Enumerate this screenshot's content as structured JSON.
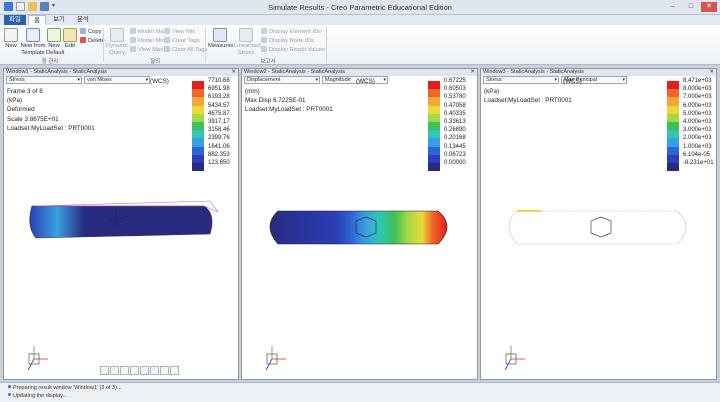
{
  "window": {
    "title": "Simulate Results - Creo Parametric Educational Edition",
    "min": "–",
    "max": "□",
    "close": "✕"
  },
  "tabs": [
    "파일",
    "홈",
    "보기",
    "분석"
  ],
  "ribbon": {
    "new": "New",
    "new_template": "New from Template",
    "new_default": "New Default",
    "edit": "Edit",
    "copy": "Copy",
    "delete": "Delete",
    "dynamic_query": "Dynamic Query",
    "model_max": "Model Max",
    "model_min": "Model Min",
    "view_max": "View Max",
    "view_min": "View Min",
    "clear_tags": "Clear Tags",
    "clear_all_tags": "Clear All Tags",
    "measures": "Measures",
    "linearized_stress": "Linearized Stress",
    "display_element_ids": "Display Element IDs",
    "display_node_ids": "Display Node IDs",
    "display_result_values": "Display Result Values",
    "group_file": "정 관리",
    "group_query": "질의",
    "group_report": "보고서"
  },
  "panels": [
    {
      "header": "Window1 - StaticAnalysis - StaticAnalysis",
      "close": "✕",
      "drop1": "Stress",
      "drop2": "von Mises",
      "wcs": "(WCS)",
      "info": [
        "Frame 3 of 8",
        "(kPa)",
        "Deformed",
        "Scale  3.8675E+01",
        "Loadset:MyLoadSet : PRT0001"
      ],
      "legend_values": [
        "7710.68",
        "6951.98",
        "6193.28",
        "5434.57",
        "4675.87",
        "3917.17",
        "3158.46",
        "2399.76",
        "1641.06",
        "882.353",
        "123.650"
      ]
    },
    {
      "header": "Window2 - StaticAnalysis - StaticAnalysis",
      "close": "✕",
      "drop1": "Displacement",
      "drop2": "Magnitude",
      "wcs": "(WCS)",
      "info": [
        "(mm)",
        "Max Disp  6.7225E-01",
        "Loadset:MyLoadSet : PRT0001"
      ],
      "legend_values": [
        "0.67225",
        "0.60503",
        "0.53780",
        "0.47058",
        "0.40335",
        "0.33613",
        "0.26890",
        "0.20168",
        "0.13445",
        "0.06723",
        "0.00000"
      ]
    },
    {
      "header": "Window3 - StaticAnalysis - StaticAnalysis",
      "close": "✕",
      "drop1": "Stress",
      "drop2": "Max Principal",
      "wcs": "(WCS)",
      "info": [
        "(kPa)",
        "Loadset:MyLoadSet : PRT0001"
      ],
      "legend_values": [
        "8.471e+03",
        "8.000e+03",
        "7.000e+03",
        "6.000e+03",
        "5.000e+03",
        "4.000e+03",
        "3.000e+03",
        "2.000e+03",
        "1.000e+03",
        "6.104e-05",
        "-8.231e+01"
      ]
    }
  ],
  "legend_colors": [
    "#e0201a",
    "#f0642a",
    "#f4a63a",
    "#e8d83a",
    "#a6d844",
    "#3cc05a",
    "#2fc6b6",
    "#3a9fe0",
    "#2f64d6",
    "#2a3fb8",
    "#282a80"
  ],
  "status": [
    "Preparing result window 'Window1' (3 of 3)...",
    "Updating the display..."
  ]
}
